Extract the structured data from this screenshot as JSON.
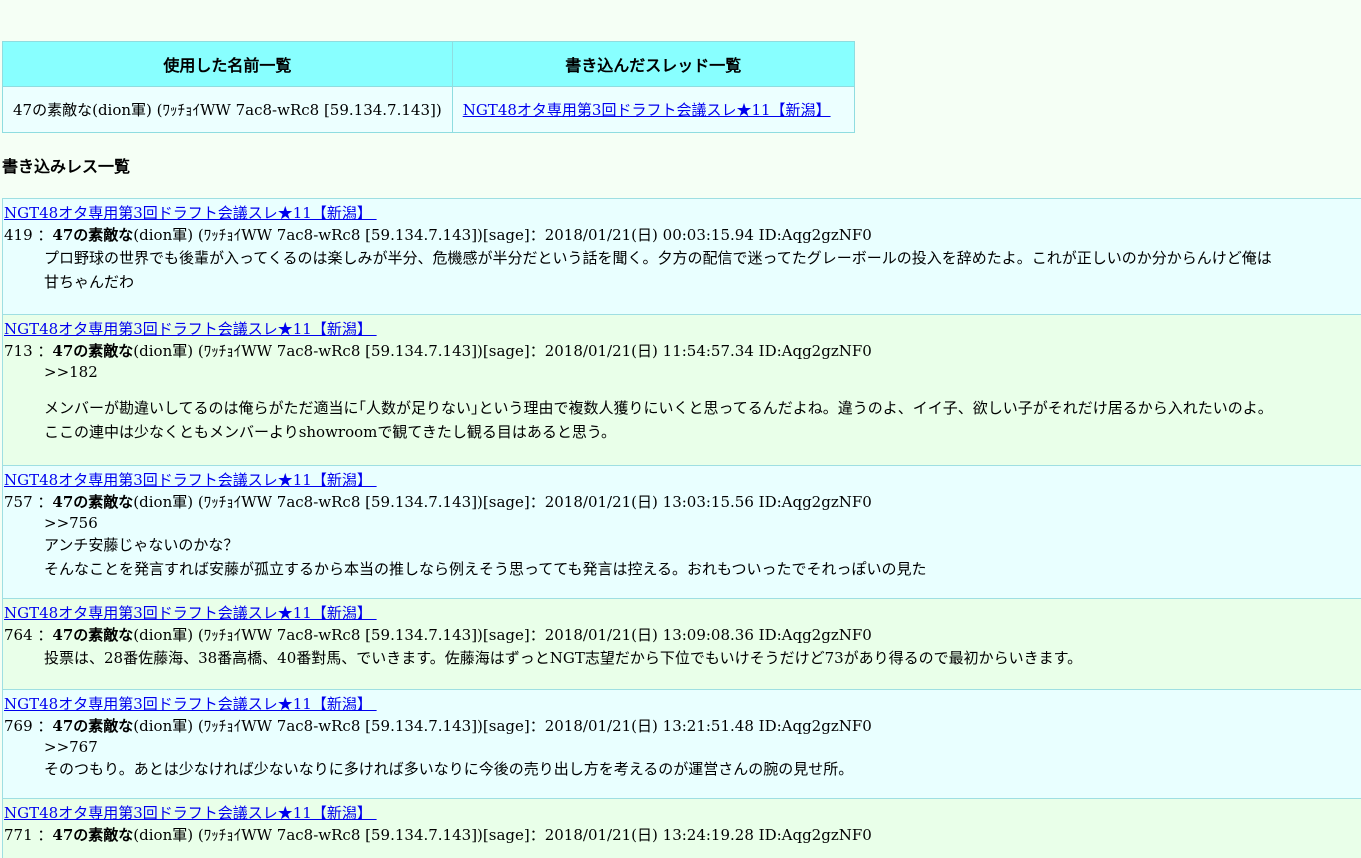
{
  "summary": {
    "col_names_header": "使用した名前一覧",
    "col_threads_header": "書き込んだスレッド一覧",
    "name": "47の素敵な(dion軍) (ﾜｯﾁｮｲWW 7ac8-wRc8 [59.134.7.143])",
    "thread_link": "NGT48オタ専用第3回ドラフト会議スレ★11【新潟】 "
  },
  "section_title": "書き込みレス一覧",
  "posts": [
    {
      "thread": "NGT48オタ専用第3回ドラフト会議スレ★11【新潟】 ",
      "num": "419 ：",
      "name_bold": "47の素敵な",
      "name_rest": "(dion軍) (ﾜｯﾁｮｲWW 7ac8-wRc8 [59.134.7.143])[sage]：2018/01/21(日) 00:03:15.94 ID:Aqg2gzNF0",
      "l1": "プロ野球の世界でも後輩が入ってくるのは楽しみが半分、危機感が半分だという話を聞く。夕方の配信で迷ってたグレーボールの投入を辞めたよ。これが正しいのか分からんけど俺は",
      "l2": "甘ちゃんだわ"
    },
    {
      "thread": "NGT48オタ専用第3回ドラフト会議スレ★11【新潟】 ",
      "num": "713 ：",
      "name_bold": "47の素敵な",
      "name_rest": "(dion軍) (ﾜｯﾁｮｲWW 7ac8-wRc8 [59.134.7.143])[sage]：2018/01/21(日) 11:54:57.34 ID:Aqg2gzNF0",
      "l1": ">>182",
      "l2": "メンバーが勘違いしてるのは俺らがただ適当に｢人数が足りない｣という理由で複数人獲りにいくと思ってるんだよね。違うのよ、イイ子、欲しい子がそれだけ居るから入れたいのよ。",
      "l3": "ここの連中は少なくともメンバーよりshowroomで観てきたし観る目はあると思う。"
    },
    {
      "thread": "NGT48オタ専用第3回ドラフト会議スレ★11【新潟】 ",
      "num": "757 ：",
      "name_bold": "47の素敵な",
      "name_rest": "(dion軍) (ﾜｯﾁｮｲWW 7ac8-wRc8 [59.134.7.143])[sage]：2018/01/21(日) 13:03:15.56 ID:Aqg2gzNF0",
      "l1": ">>756",
      "l2": "アンチ安藤じゃないのかな？",
      "l3": "そんなことを発言すれば安藤が孤立するから本当の推しなら例えそう思ってても発言は控える。おれもついったでそれっぽいの見た"
    },
    {
      "thread": "NGT48オタ専用第3回ドラフト会議スレ★11【新潟】 ",
      "num": "764 ：",
      "name_bold": "47の素敵な",
      "name_rest": "(dion軍) (ﾜｯﾁｮｲWW 7ac8-wRc8 [59.134.7.143])[sage]：2018/01/21(日) 13:09:08.36 ID:Aqg2gzNF0",
      "l1": "投票は、28番佐藤海、38番高橋、40番對馬、でいきます。佐藤海はずっとNGT志望だから下位でもいけそうだけど73があり得るので最初からいきます。"
    },
    {
      "thread": "NGT48オタ専用第3回ドラフト会議スレ★11【新潟】 ",
      "num": "769 ：",
      "name_bold": "47の素敵な",
      "name_rest": "(dion軍) (ﾜｯﾁｮｲWW 7ac8-wRc8 [59.134.7.143])[sage]：2018/01/21(日) 13:21:51.48 ID:Aqg2gzNF0",
      "l1": ">>767",
      "l2": "そのつもり。あとは少なければ少ないなりに多ければ多いなりに今後の売り出し方を考えるのが運営さんの腕の見せ所。"
    },
    {
      "thread": "NGT48オタ専用第3回ドラフト会議スレ★11【新潟】 ",
      "num": "771 ：",
      "name_bold": "47の素敵な",
      "name_rest": "(dion軍) (ﾜｯﾁｮｲWW 7ac8-wRc8 [59.134.7.143])[sage]：2018/01/21(日) 13:24:19.28 ID:Aqg2gzNF0"
    }
  ]
}
